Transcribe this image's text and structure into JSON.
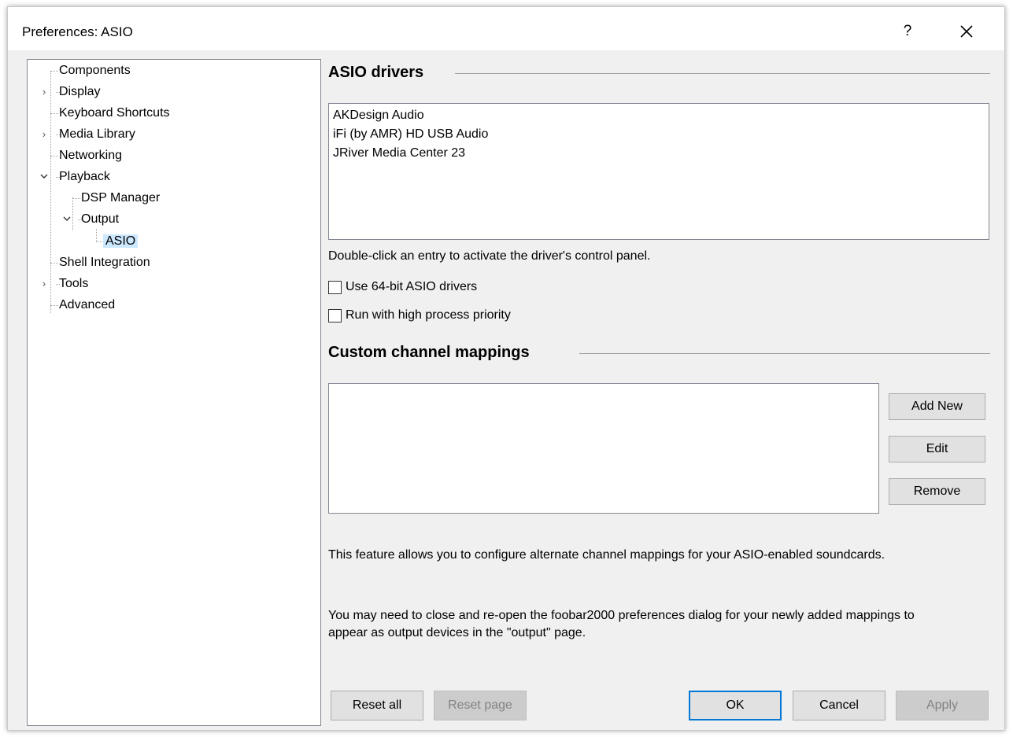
{
  "window": {
    "title": "Preferences: ASIO",
    "help_label": "?",
    "close_icon": "close-icon"
  },
  "tree": {
    "items": [
      {
        "label": "Components",
        "expander": ""
      },
      {
        "label": "Display",
        "expander": "collapsed"
      },
      {
        "label": "Keyboard Shortcuts",
        "expander": ""
      },
      {
        "label": "Media Library",
        "expander": "collapsed"
      },
      {
        "label": "Networking",
        "expander": ""
      },
      {
        "label": "Playback",
        "expander": "expanded"
      },
      {
        "label": "DSP Manager",
        "expander": ""
      },
      {
        "label": "Output",
        "expander": "expanded"
      },
      {
        "label": "ASIO",
        "expander": "",
        "selected": true
      },
      {
        "label": "Shell Integration",
        "expander": ""
      },
      {
        "label": "Tools",
        "expander": "collapsed"
      },
      {
        "label": "Advanced",
        "expander": ""
      }
    ]
  },
  "asio": {
    "section_title": "ASIO drivers",
    "drivers": [
      "AKDesign Audio",
      "iFi (by AMR) HD USB Audio",
      "JRiver Media Center 23"
    ],
    "hint": "Double-click an entry to activate the driver's control panel.",
    "use_64bit_label": "Use 64-bit ASIO drivers",
    "use_64bit_checked": false,
    "high_priority_label": "Run with high process priority",
    "high_priority_checked": false
  },
  "mappings": {
    "section_title": "Custom channel mappings",
    "add_new_label": "Add New",
    "edit_label": "Edit",
    "remove_label": "Remove",
    "description_1": "This feature allows you to configure alternate channel mappings for your ASIO-enabled soundcards.",
    "description_2": "You may need to close and re-open the foobar2000 preferences dialog for your newly added mappings to appear as output devices in the \"output\" page."
  },
  "footer": {
    "reset_all_label": "Reset all",
    "reset_page_label": "Reset page",
    "ok_label": "OK",
    "cancel_label": "Cancel",
    "apply_label": "Apply"
  }
}
